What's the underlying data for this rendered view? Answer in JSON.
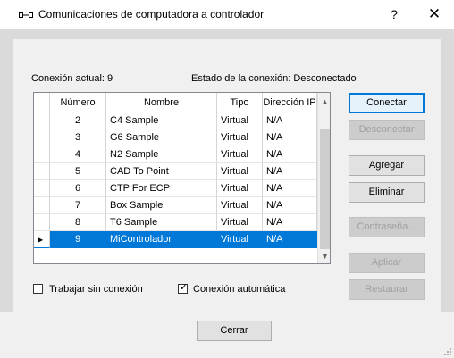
{
  "window": {
    "title": "Comunicaciones de computadora a controlador",
    "help": "?",
    "close": "✕"
  },
  "status": {
    "current_connection": "Conexión actual: 9",
    "connection_state": "Estado de la conexión: Desconectado"
  },
  "table": {
    "columns": [
      "Número",
      "Nombre",
      "Tipo",
      "Dirección IP"
    ],
    "rows": [
      {
        "num": "2",
        "name": "C4 Sample",
        "type": "Virtual",
        "ip": "N/A"
      },
      {
        "num": "3",
        "name": "G6 Sample",
        "type": "Virtual",
        "ip": "N/A"
      },
      {
        "num": "4",
        "name": "N2 Sample",
        "type": "Virtual",
        "ip": "N/A"
      },
      {
        "num": "5",
        "name": "CAD To Point",
        "type": "Virtual",
        "ip": "N/A"
      },
      {
        "num": "6",
        "name": "CTP For ECP",
        "type": "Virtual",
        "ip": "N/A"
      },
      {
        "num": "7",
        "name": "Box Sample",
        "type": "Virtual",
        "ip": "N/A"
      },
      {
        "num": "8",
        "name": "T6 Sample",
        "type": "Virtual",
        "ip": "N/A"
      },
      {
        "num": "9",
        "name": "MiControlador",
        "type": "Virtual",
        "ip": "N/A"
      }
    ],
    "selected_indicator": "▶"
  },
  "buttons": {
    "connect": "Conectar",
    "disconnect": "Desconectar",
    "add": "Agregar",
    "remove": "Eliminar",
    "password": "Contraseña...",
    "apply": "Aplicar",
    "restore": "Restaurar",
    "close": "Cerrar"
  },
  "options": {
    "offline": {
      "label": "Trabajar sin conexión",
      "checked": false
    },
    "auto_connect": {
      "label": "Conexión automática",
      "checked": true
    }
  },
  "colors": {
    "selection": "#0078d7",
    "primary_border": "#0078d7"
  }
}
